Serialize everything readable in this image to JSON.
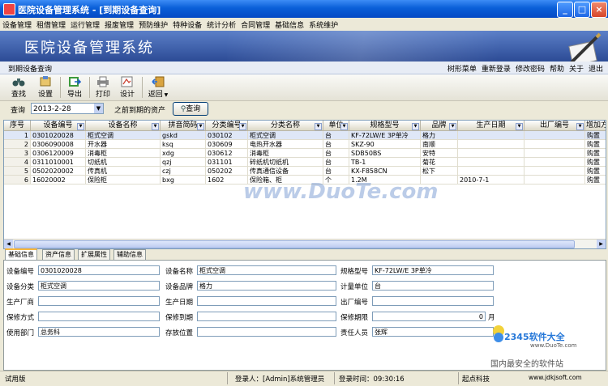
{
  "window": {
    "title": "医院设备管理系统 - [到期设备查询]"
  },
  "menu": [
    "设备管理",
    "租借管理",
    "运行管理",
    "报废管理",
    "预防维护",
    "特种设备",
    "统计分析",
    "合同管理",
    "基础信息",
    "系统维护"
  ],
  "banner": {
    "title": "医院设备管理系统"
  },
  "subbar": {
    "title": "到期设备查询",
    "links": [
      "树形菜单",
      "重新登录",
      "修改密码",
      "帮助",
      "关于",
      "退出"
    ]
  },
  "toolbar": {
    "items": [
      "查找",
      "设置",
      "导出",
      "打印",
      "设计",
      "返回"
    ]
  },
  "query": {
    "label": "查询",
    "date": "2013-2-28",
    "suffix": "之前到期的资产",
    "button": "查询"
  },
  "grid": {
    "columns": [
      "序号",
      "设备编号",
      "设备名称",
      "拼音简码",
      "分类编号",
      "分类名称",
      "单位",
      "规格型号",
      "品牌",
      "生产日期",
      "出厂编号",
      "增加方"
    ],
    "rows": [
      [
        "1",
        "0301020028",
        "柜式空调",
        "gskd",
        "030102",
        "柜式空调",
        "台",
        "KF-72LW/E 3P单冷",
        "格力",
        "",
        "",
        "购置"
      ],
      [
        "2",
        "0306090008",
        "开水器",
        "ksq",
        "030609",
        "电热开水器",
        "台",
        "SKZ-90",
        "南顺",
        "",
        "",
        "购置"
      ],
      [
        "3",
        "0306120009",
        "消毒柜",
        "xdg",
        "030612",
        "消毒柜",
        "台",
        "SDB50BS",
        "安特",
        "",
        "",
        "购置"
      ],
      [
        "4",
        "0311010001",
        "切纸机",
        "qzj",
        "031101",
        "碎纸机切纸机",
        "台",
        "TB-1",
        "菊花",
        "",
        "",
        "购置"
      ],
      [
        "5",
        "0502020002",
        "传真机",
        "czj",
        "050202",
        "传真通信设备",
        "台",
        "KX-F858CN",
        "松下",
        "",
        "",
        "购置"
      ],
      [
        "6",
        "16020002",
        "保险柜",
        "bxg",
        "1602",
        "保险箱、柜",
        "个",
        "1.2M",
        "",
        "2010-7-1",
        "",
        "购置"
      ]
    ]
  },
  "tabs": [
    "基础信息",
    "资产信息",
    "扩展属性",
    "辅助信息"
  ],
  "form": {
    "code_label": "设备编号",
    "code": "0301020028",
    "name_label": "设备名称",
    "name": "柜式空调",
    "spec_label": "规格型号",
    "spec": "KF-72LW/E 3P单冷",
    "cat_label": "设备分类",
    "cat": "柜式空调",
    "brand_label": "设备品牌",
    "brand": "格力",
    "unit_label": "计量单位",
    "unit": "台",
    "maker_label": "生产厂商",
    "maker": "",
    "mdate_label": "生产日期",
    "mdate": "",
    "serial_label": "出厂编号",
    "serial": "",
    "warranty_label": "保修方式",
    "warranty": "",
    "wend_label": "保修到期",
    "wend": "",
    "wperiod_label": "保修期限",
    "wperiod": "0",
    "wperiod_unit": "月",
    "dept_label": "使用部门",
    "dept": "总务科",
    "loc_label": "存放位置",
    "loc": "",
    "owner_label": "责任人员",
    "owner": "张辉"
  },
  "status": {
    "version": "试用版",
    "user": "登录人：[Admin]系统管理员",
    "time": "登录时间：09:30:16",
    "company": "起点科技",
    "site": "www.jdkjsoft.com"
  },
  "watermark": {
    "duote": "www.DuoTe.com",
    "brand": "2345软件大全",
    "duote2": "www.DuoTe.com",
    "slogan": "国内最安全的软件站"
  }
}
